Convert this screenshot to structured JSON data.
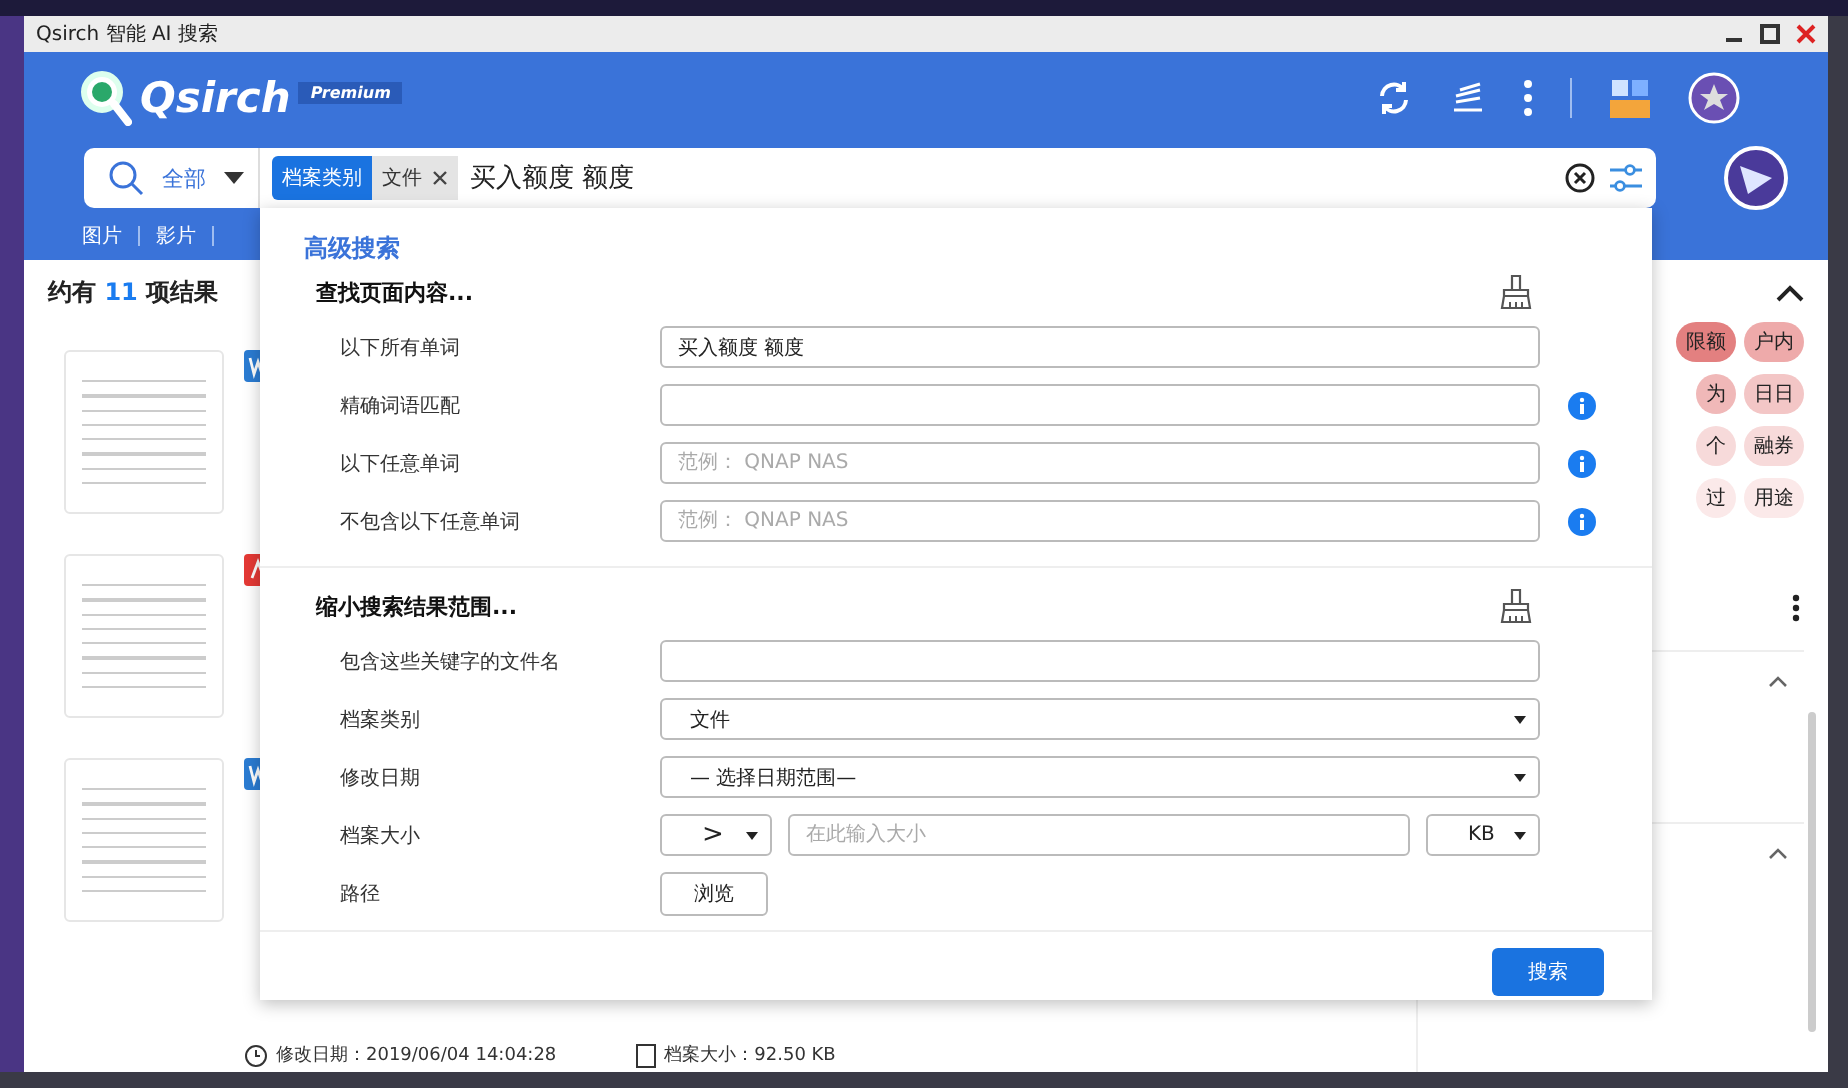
{
  "window": {
    "title": "Qsirch 智能 AI 搜索"
  },
  "header": {
    "logo": "Qsirch",
    "badge": "Premium"
  },
  "search": {
    "scope": "全部",
    "chips": [
      {
        "label": "档案类别",
        "kind": "category"
      },
      {
        "label": "文件",
        "kind": "value"
      }
    ],
    "query": "买入额度 额度"
  },
  "type_tabs": [
    "图片",
    "影片"
  ],
  "results": {
    "count_prefix": "约有",
    "count": "11",
    "count_suffix": "项结果",
    "items": [
      {
        "kind": "word"
      },
      {
        "kind": "pdf"
      },
      {
        "kind": "word"
      }
    ],
    "modified": "修改日期：2019/06/04 14:04:28",
    "size": "档案大小：92.50 KB"
  },
  "tags": [
    {
      "label": "限额",
      "color": "#e38080"
    },
    {
      "label": "户内",
      "color": "#eeaaaa"
    },
    {
      "label": "为",
      "color": "#f0b8b8"
    },
    {
      "label": "日日",
      "color": "#f3c6c6"
    },
    {
      "label": "个",
      "color": "#f7dada"
    },
    {
      "label": "融券",
      "color": "#f7dada"
    },
    {
      "label": "过",
      "color": "#fbe9e9"
    },
    {
      "label": "用途",
      "color": "#fbe9e9"
    }
  ],
  "advanced_search": {
    "title": "高级搜索",
    "submit": "搜索",
    "sections": [
      {
        "heading": "查找页面内容...",
        "fields": [
          {
            "label": "以下所有单词",
            "kind": "text",
            "value": "买入额度 额度",
            "info": false
          },
          {
            "label": "精确词语匹配",
            "kind": "text",
            "info": true
          },
          {
            "label": "以下任意单词",
            "kind": "text",
            "placeholder": "范例： QNAP NAS",
            "info": true
          },
          {
            "label": "不包含以下任意单词",
            "kind": "text",
            "placeholder": "范例： QNAP NAS",
            "info": true
          }
        ]
      },
      {
        "heading": "缩小搜索结果范围...",
        "fields": [
          {
            "label": "包含这些关键字的文件名",
            "kind": "text",
            "info": false
          },
          {
            "label": "档案类别",
            "kind": "select",
            "value": "文件"
          },
          {
            "label": "修改日期",
            "kind": "select",
            "value": "— 选择日期范围—"
          },
          {
            "label": "档案大小",
            "kind": "size",
            "operator": ">",
            "placeholder": "在此输入大小",
            "unit": "KB"
          },
          {
            "label": "路径",
            "kind": "button",
            "button": "浏览"
          }
        ]
      }
    ]
  }
}
